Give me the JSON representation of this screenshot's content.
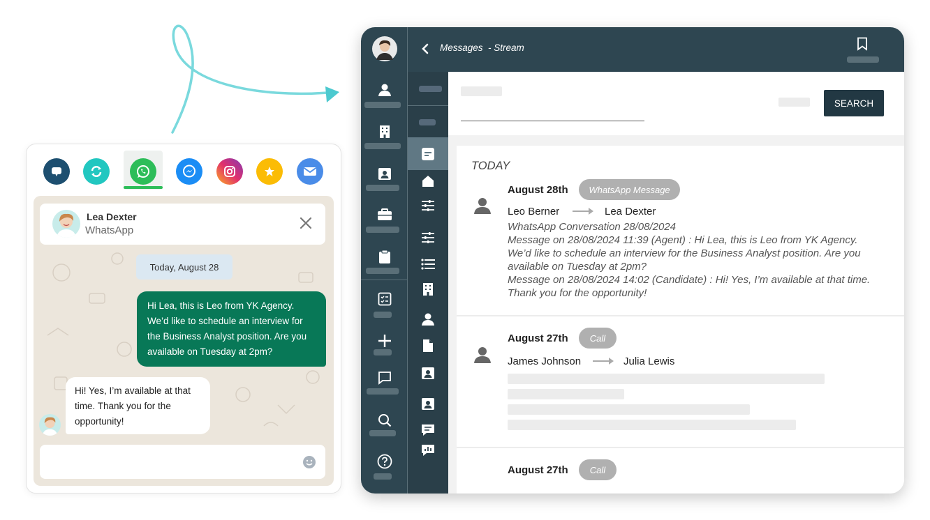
{
  "chat_widget": {
    "channels": [
      {
        "name": "chat",
        "icon": "speech-bubble-icon",
        "color": "#1d4f70"
      },
      {
        "name": "sync",
        "icon": "sync-icon",
        "color": "#22c7c0"
      },
      {
        "name": "whatsapp",
        "icon": "whatsapp-icon",
        "color": "#2dbd59",
        "active": true
      },
      {
        "name": "messenger",
        "icon": "messenger-icon",
        "color": "#1b8df5"
      },
      {
        "name": "instagram",
        "icon": "instagram-icon",
        "color": "#d6249f"
      },
      {
        "name": "reviews",
        "icon": "star-icon",
        "color": "#fbbc05"
      },
      {
        "name": "email",
        "icon": "mail-icon",
        "color": "#4a8ce8"
      }
    ],
    "contact": {
      "name": "Lea Dexter",
      "channel": "WhatsApp"
    },
    "date_label": "Today, August 28",
    "outgoing": [
      "Hi Lea, this is Leo from YK Agency.",
      "We’d like to schedule an interview for",
      "the Business Analyst position. Are you",
      "available on Tuesday at 2pm?"
    ],
    "incoming": [
      "Hi! Yes, I’m available at that",
      "time. Thank you for the",
      "opportunity!"
    ]
  },
  "app": {
    "title": "Messages",
    "subtitle": "- Stream",
    "search_label": "SEARCH",
    "stream": {
      "section_label": "TODAY",
      "items": [
        {
          "date": "August 28th",
          "type": "WhatsApp Message",
          "from": "Leo Berner",
          "to": "Lea Dexter",
          "lines": [
            "WhatsApp Conversation 28/08/2024",
            "Message on 28/08/2024 11:39 (Agent) : Hi Lea, this is Leo from YK Agency.",
            "We’d like to schedule an interview for the Business Analyst position. Are you",
            "available on Tuesday at 2pm?",
            "Message on 28/08/2024 14:02 (Candidate) : Hi! Yes, I’m available at that time.",
            "Thank you for the opportunity!"
          ]
        },
        {
          "date": "August 27th",
          "type": "Call",
          "from": "James Johnson",
          "to": "Julia Lewis"
        },
        {
          "date": "August 27th",
          "type": "Call"
        }
      ]
    }
  }
}
